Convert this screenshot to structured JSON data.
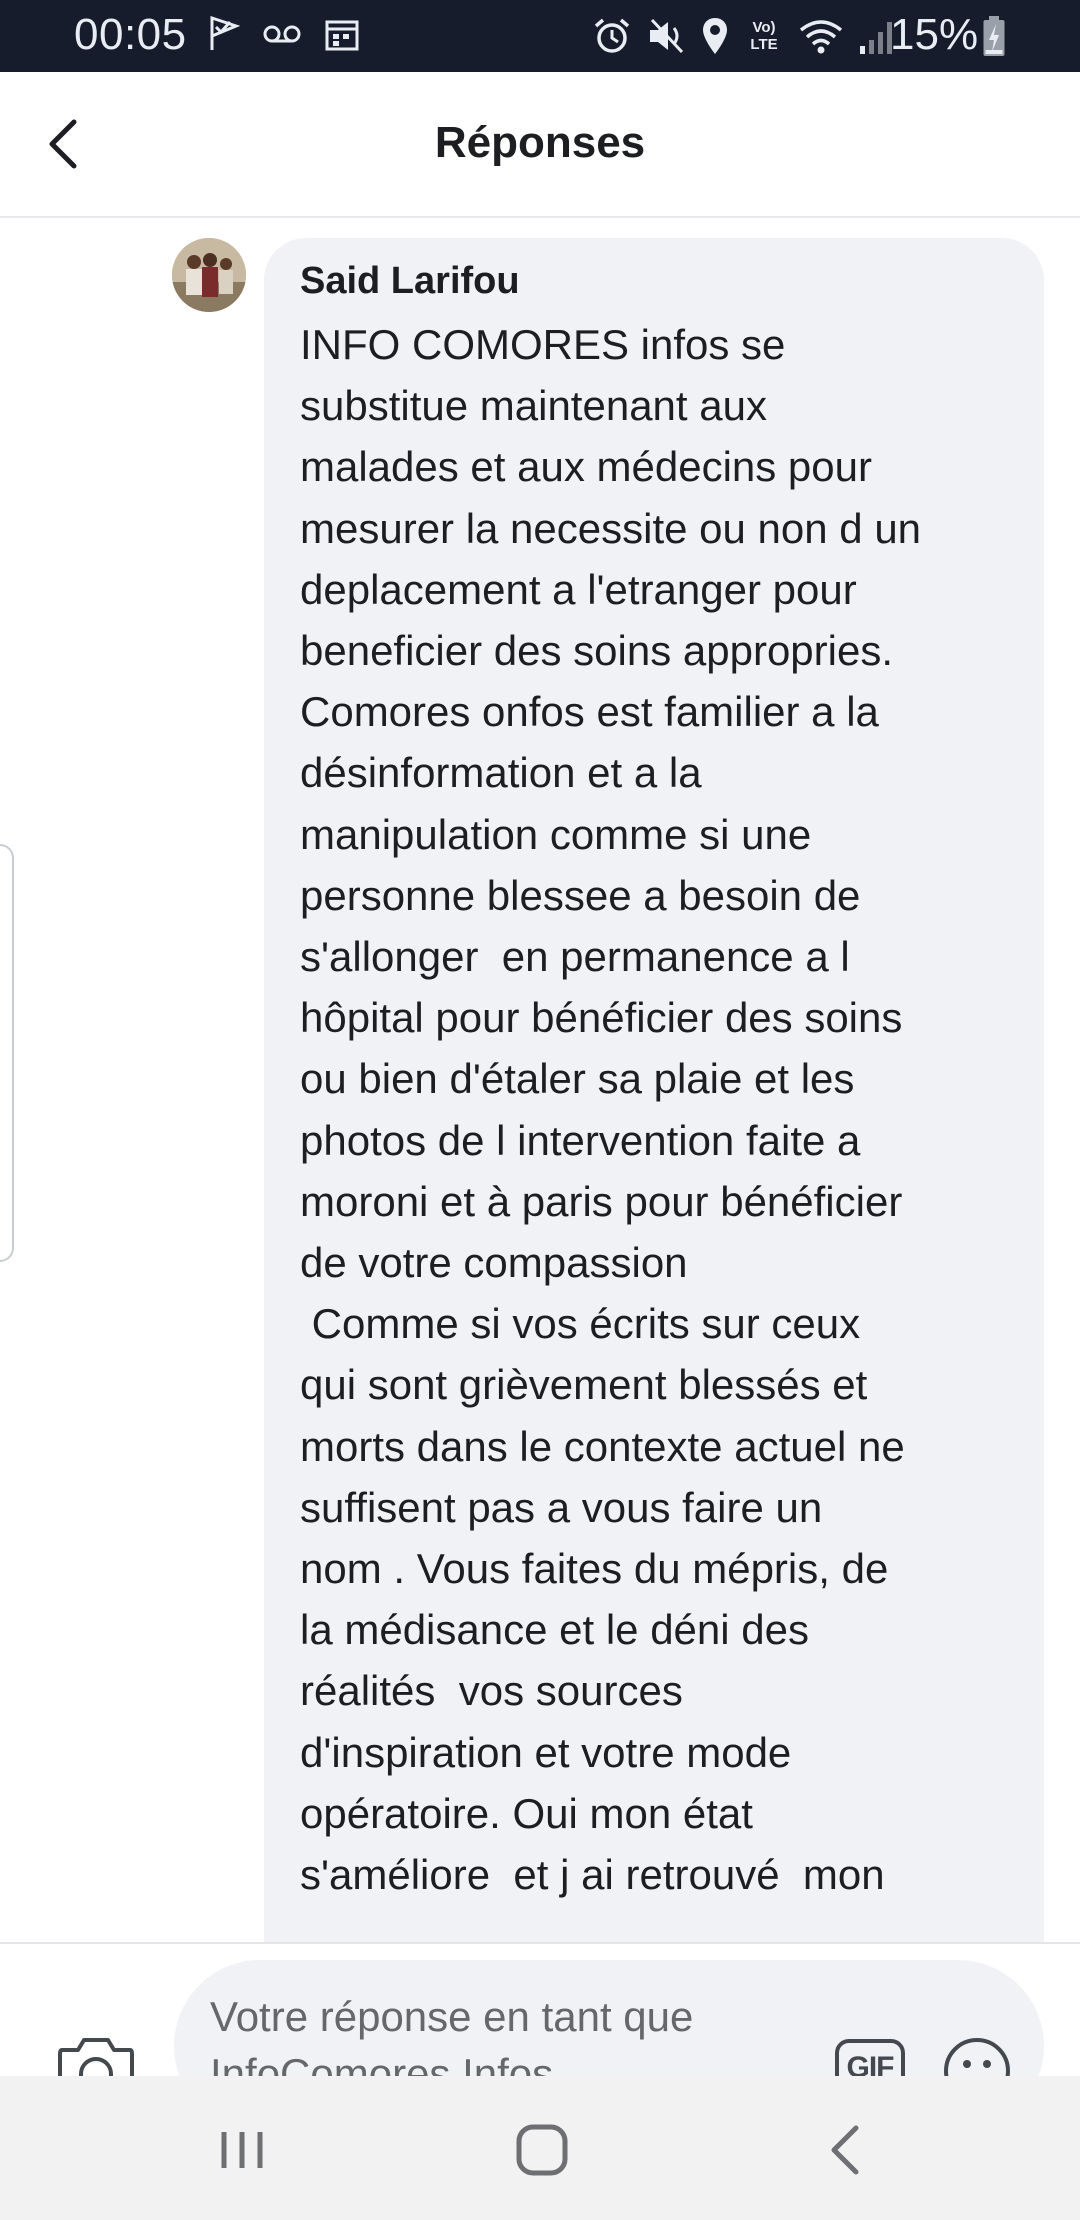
{
  "status_bar": {
    "time": "00:05",
    "left_icons": [
      "check-flag-icon",
      "voicemail-icon",
      "calendar-icon"
    ],
    "right_icons": [
      "alarm-icon",
      "mute-icon",
      "location-icon",
      "volte-icon",
      "wifi-icon",
      "signal-icon"
    ],
    "volte_label": "Vo) LTE",
    "battery_text": "15%"
  },
  "header": {
    "title": "Réponses",
    "back_icon": "chevron-left-icon"
  },
  "comment": {
    "author": "Said Larifou",
    "text": "INFO COMORES infos se\nsubstitue maintenant aux\nmalades et aux médecins pour\nmesurer la necessite ou non d un\ndeplacement a l'etranger pour\nbeneficier des soins appropries.\nComores onfos est familier a la\ndésinformation et a la\nmanipulation comme si une\npersonne blessee a besoin de\ns'allonger  en permanence a l\nhôpital pour bénéficier des soins\nou bien d'étaler sa plaie et les\nphotos de l intervention faite a\nmoroni et à paris pour bénéficier\nde votre compassion\n Comme si vos écrits sur ceux\nqui sont grièvement blessés et\nmorts dans le contexte actuel ne\nsuffisent pas a vous faire un\nnom . Vous faites du mépris, de\nla médisance et le déni des\nréalités  vos sources\nd'inspiration et votre mode\nopératoire. Oui mon état\ns'améliore  et j ai retrouvé  mon"
  },
  "composer": {
    "placeholder": "Votre réponse en tant que InfoComores Infos",
    "gif_label": "GIF",
    "icons": [
      "camera-icon",
      "gif-icon",
      "emoji-icon"
    ]
  },
  "nav_bar": {
    "icons": [
      "recent-apps-icon",
      "home-icon",
      "back-icon"
    ]
  },
  "colors": {
    "status_bar_bg": "#161c2b",
    "bubble_bg": "#f0f2f5",
    "text": "#1c1e21",
    "placeholder": "#65676b",
    "nav_bg": "#f2f2f2"
  }
}
